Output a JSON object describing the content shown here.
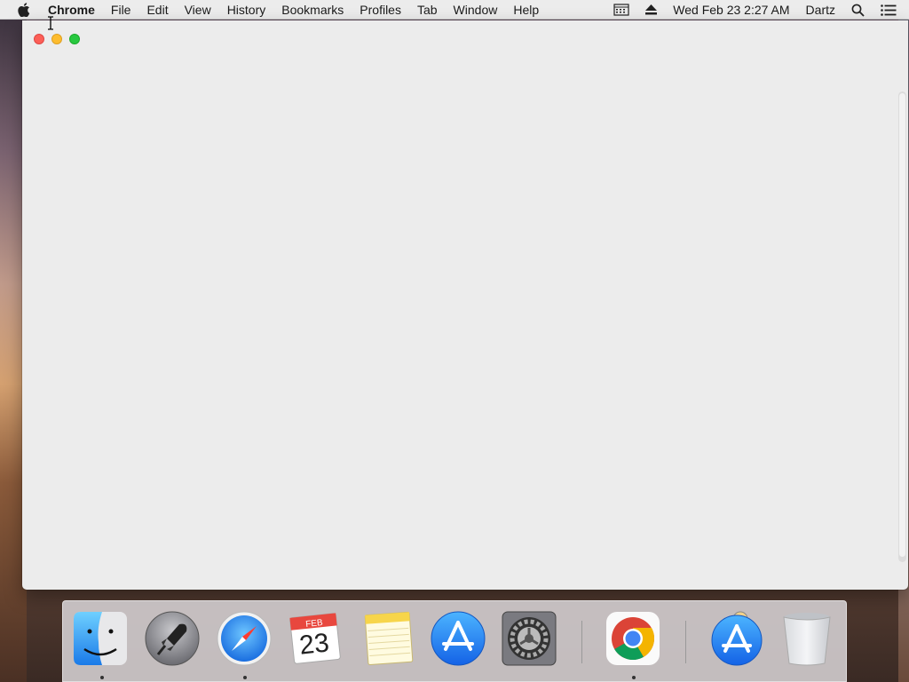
{
  "menubar": {
    "app_name": "Chrome",
    "items": [
      "File",
      "Edit",
      "View",
      "History",
      "Bookmarks",
      "Profiles",
      "Tab",
      "Window",
      "Help"
    ],
    "clock": "Wed Feb 23  2:27 AM",
    "user": "Dartz"
  },
  "dock": {
    "items": [
      {
        "name": "Finder",
        "running": true
      },
      {
        "name": "Launchpad",
        "running": false
      },
      {
        "name": "Safari",
        "running": true
      },
      {
        "name": "Calendar",
        "running": false,
        "month": "FEB",
        "day": "23"
      },
      {
        "name": "Notes",
        "running": false
      },
      {
        "name": "App Store",
        "running": false
      },
      {
        "name": "System Preferences",
        "running": false
      },
      {
        "name": "Google Chrome",
        "running": true
      },
      {
        "name": "App Store Downloads",
        "running": false
      },
      {
        "name": "Trash",
        "running": false
      }
    ]
  },
  "colors": {
    "close": "#fc5f57",
    "minimize": "#fdbc2e",
    "maximize": "#28c840",
    "window_bg": "#ececec"
  }
}
